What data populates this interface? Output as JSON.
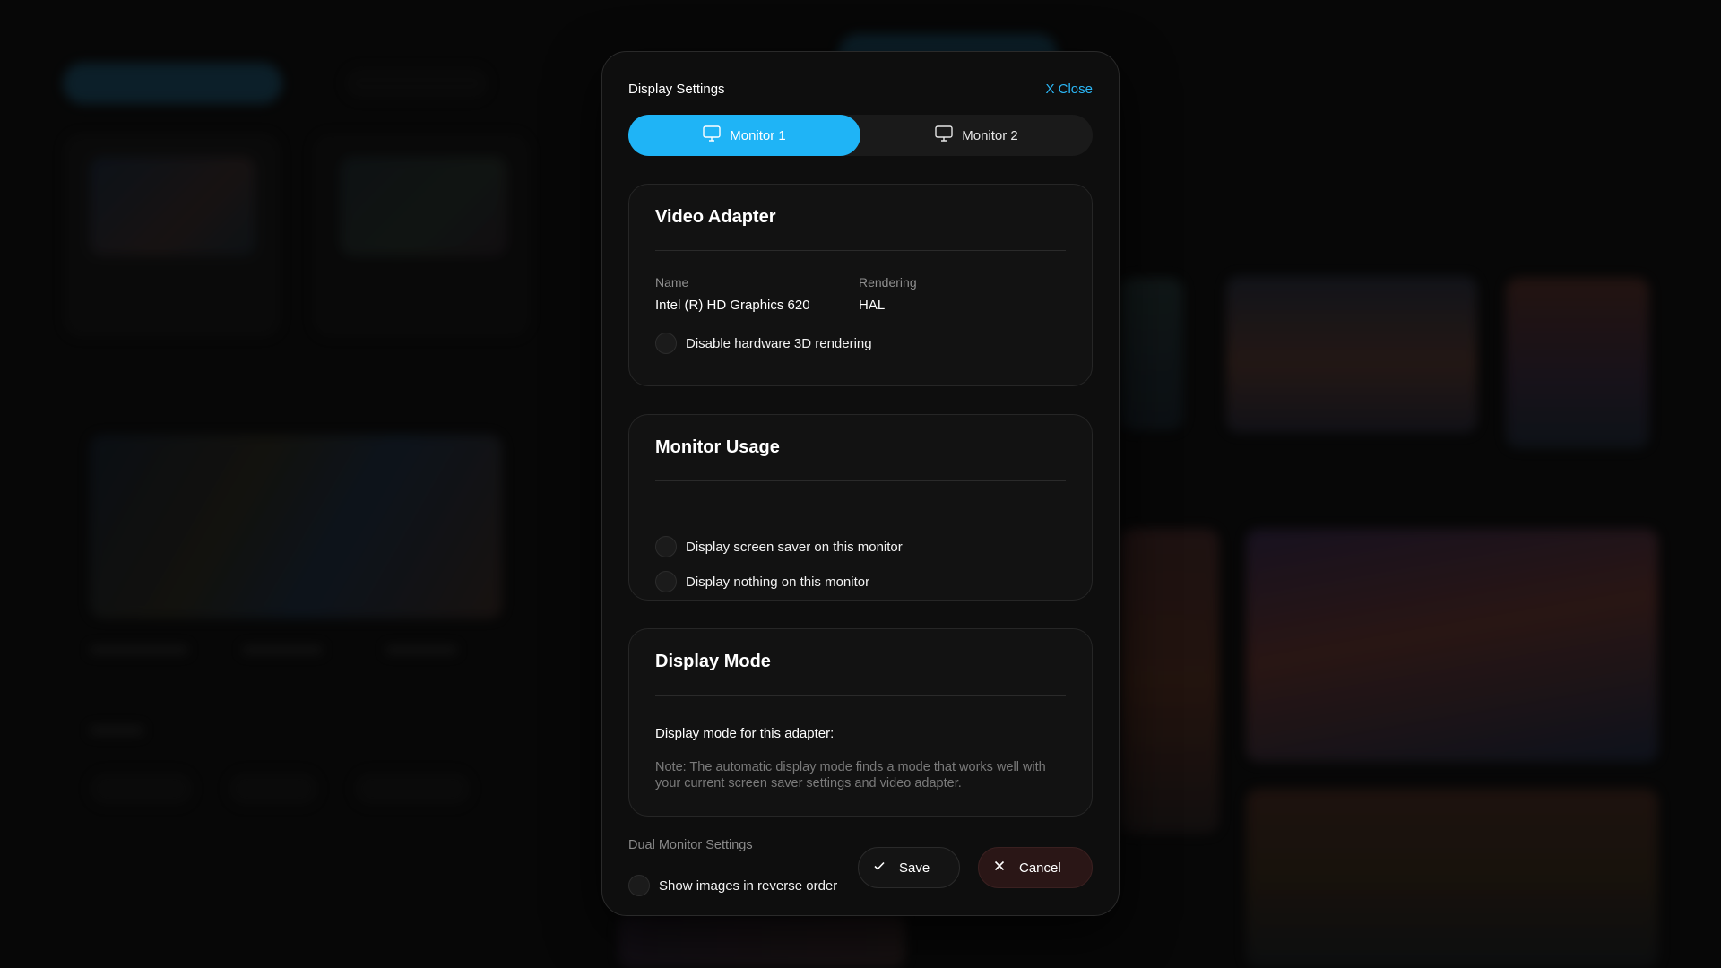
{
  "modal": {
    "title": "Display Settings",
    "close_label": "X Close"
  },
  "tabs": [
    {
      "label": "Monitor 1",
      "icon": "monitor-icon",
      "active": true
    },
    {
      "label": "Monitor 2",
      "icon": "monitor-icon",
      "active": false
    }
  ],
  "video_adapter": {
    "title": "Video Adapter",
    "name_label": "Name",
    "name_value": "Intel (R) HD Graphics 620",
    "rendering_label": "Rendering",
    "rendering_value": "HAL",
    "option_disable_3d": "Disable hardware 3D rendering"
  },
  "monitor_usage": {
    "title": "Monitor Usage",
    "option_screensaver": "Display screen saver on this monitor",
    "option_nothing": "Display nothing on this monitor"
  },
  "display_mode": {
    "title": "Display Mode",
    "label": "Display mode for this adapter:",
    "note": "Note: The automatic display mode finds a mode that works well with your current screen saver settings and video adapter."
  },
  "dual_monitor": {
    "label": "Dual Monitor Settings",
    "option_reverse": "Show images in reverse order"
  },
  "buttons": {
    "save": "Save",
    "cancel": "Cancel"
  },
  "colors": {
    "accent": "#1fb4f6",
    "close_link": "#2bb6f5",
    "cancel_bg": "#2a1616"
  }
}
